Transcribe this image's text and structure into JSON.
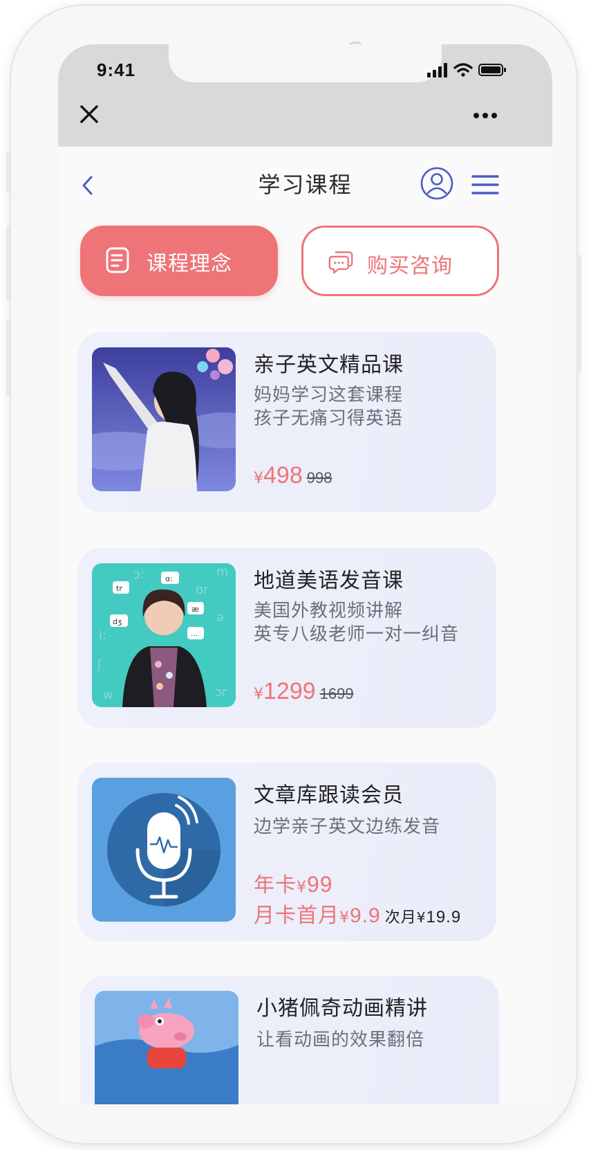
{
  "status_bar": {
    "time": "9:41"
  },
  "nav": {
    "title": "学习课程"
  },
  "actions": {
    "left_label": "课程理念",
    "right_label": "购买咨询"
  },
  "colors": {
    "accent": "#ee7478",
    "nav_blue": "#4b5bc3",
    "card_bg": "#eceefa"
  },
  "courses": [
    {
      "title": "亲子英文精品课",
      "desc1": "妈妈学习这套课程",
      "desc2": "孩子无痛习得英语",
      "currency": "¥",
      "price": "498",
      "original": "998"
    },
    {
      "title": "地道美语发音课",
      "desc1": "美国外教视频讲解",
      "desc2": "英专八级老师一对一纠音",
      "currency": "¥",
      "price": "1299",
      "original": "1699",
      "thumb_labels": {
        "a": "tr",
        "b": "ɑ:",
        "c": "æ",
        "d": "dʒ",
        "e": "...",
        "f": "i:",
        "g": "ʊr",
        "h": "ə",
        "i": "m",
        "j": "ɔ:",
        "k": "ʃ",
        "l": "w",
        "m": "ɪ",
        "n": "ɔr"
      }
    },
    {
      "title": "文章库跟读会员",
      "desc1": "边学亲子英文边练发音",
      "year_label": "年卡",
      "year_yen": "¥",
      "year_price": "99",
      "month_label": "月卡首月",
      "month_yen": "¥",
      "month_price": "9.9",
      "next_label": "次月",
      "next_yen": "¥",
      "next_price": "19.9"
    },
    {
      "title": "小猪佩奇动画精讲",
      "desc1": "让看动画的效果翻倍"
    }
  ]
}
